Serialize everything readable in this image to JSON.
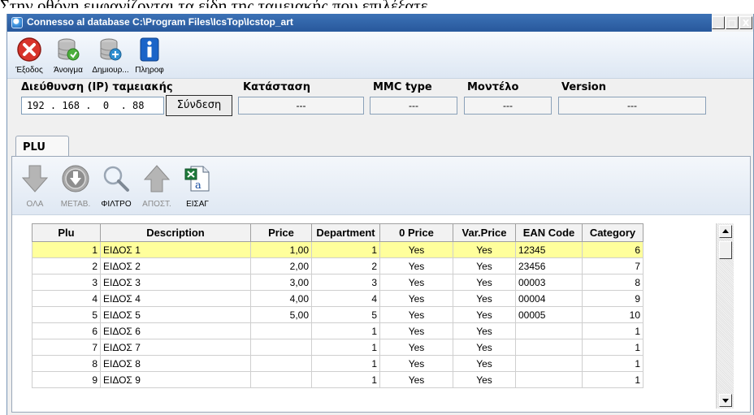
{
  "caption": "Στην οθόνη εμφανίζονται τα είδη της ταμειακής που επιλέξατε.",
  "window": {
    "title": "Connesso al database C:\\Program Files\\IcsTop\\Icstop_art",
    "min_label": "_",
    "max_label": "□",
    "close_label": "X"
  },
  "toolbar": {
    "exit": {
      "label": "Έξοδος",
      "icon": "exit-icon",
      "color": "#d8342b"
    },
    "open": {
      "label": "Άνοιγμα",
      "icon": "database-open-icon"
    },
    "create": {
      "label": "Δημιουρ...",
      "icon": "database-create-icon"
    },
    "info": {
      "label": "Πληροφ",
      "icon": "info-icon",
      "color": "#1a64c8"
    }
  },
  "connection": {
    "ip_label": "Διεύθυνση (IP) ταμειακής",
    "ip_value": "192 . 168 .  0  . 88",
    "connect_label": "Σύνδεση",
    "status_label": "Κατάσταση",
    "status_value": "---",
    "mmc_label": "MMC type",
    "mmc_value": "---",
    "model_label": "Μοντέλο",
    "model_value": "---",
    "version_label": "Version",
    "version_value": "---"
  },
  "tabs": [
    "PLU"
  ],
  "plu_toolbar": {
    "all": {
      "label": "ΟΛΑ",
      "icon": "arrow-down-icon",
      "enabled": false
    },
    "transfer": {
      "label": "ΜΕΤΑΒ.",
      "icon": "download-circle-icon",
      "enabled": false
    },
    "filter": {
      "label": "ΦΙΛΤΡΟ",
      "icon": "magnifier-icon",
      "enabled": true
    },
    "send": {
      "label": "ΑΠΟΣΤ.",
      "icon": "arrow-up-icon",
      "enabled": false
    },
    "import": {
      "label": "ΕΙΣΑΓ",
      "icon": "excel-import-icon",
      "enabled": true
    }
  },
  "grid": {
    "columns": [
      "Plu",
      "Description",
      "Price",
      "Department",
      "0 Price",
      "Var.Price",
      "EAN Code",
      "Category"
    ],
    "selected_row": 0,
    "selected_color": "#ffff9c",
    "rows": [
      [
        "1",
        "ΕΙΔΟΣ 1",
        "1,00",
        "1",
        "Yes",
        "Yes",
        "12345",
        "6"
      ],
      [
        "2",
        "ΕΙΔΟΣ 2",
        "2,00",
        "2",
        "Yes",
        "Yes",
        "23456",
        "7"
      ],
      [
        "3",
        "ΕΙΔΟΣ 3",
        "3,00",
        "3",
        "Yes",
        "Yes",
        "00003",
        "8"
      ],
      [
        "4",
        "ΕΙΔΟΣ 4",
        "4,00",
        "4",
        "Yes",
        "Yes",
        "00004",
        "9"
      ],
      [
        "5",
        "ΕΙΔΟΣ 5",
        "5,00",
        "5",
        "Yes",
        "Yes",
        "00005",
        "10"
      ],
      [
        "6",
        "ΕΙΔΟΣ 6",
        "",
        "1",
        "Yes",
        "Yes",
        "",
        "1"
      ],
      [
        "7",
        "ΕΙΔΟΣ 7",
        "",
        "1",
        "Yes",
        "Yes",
        "",
        "1"
      ],
      [
        "8",
        "ΕΙΔΟΣ 8",
        "",
        "1",
        "Yes",
        "Yes",
        "",
        "1"
      ],
      [
        "9",
        "ΕΙΔΟΣ 9",
        "",
        "1",
        "Yes",
        "Yes",
        "",
        "1"
      ]
    ]
  }
}
